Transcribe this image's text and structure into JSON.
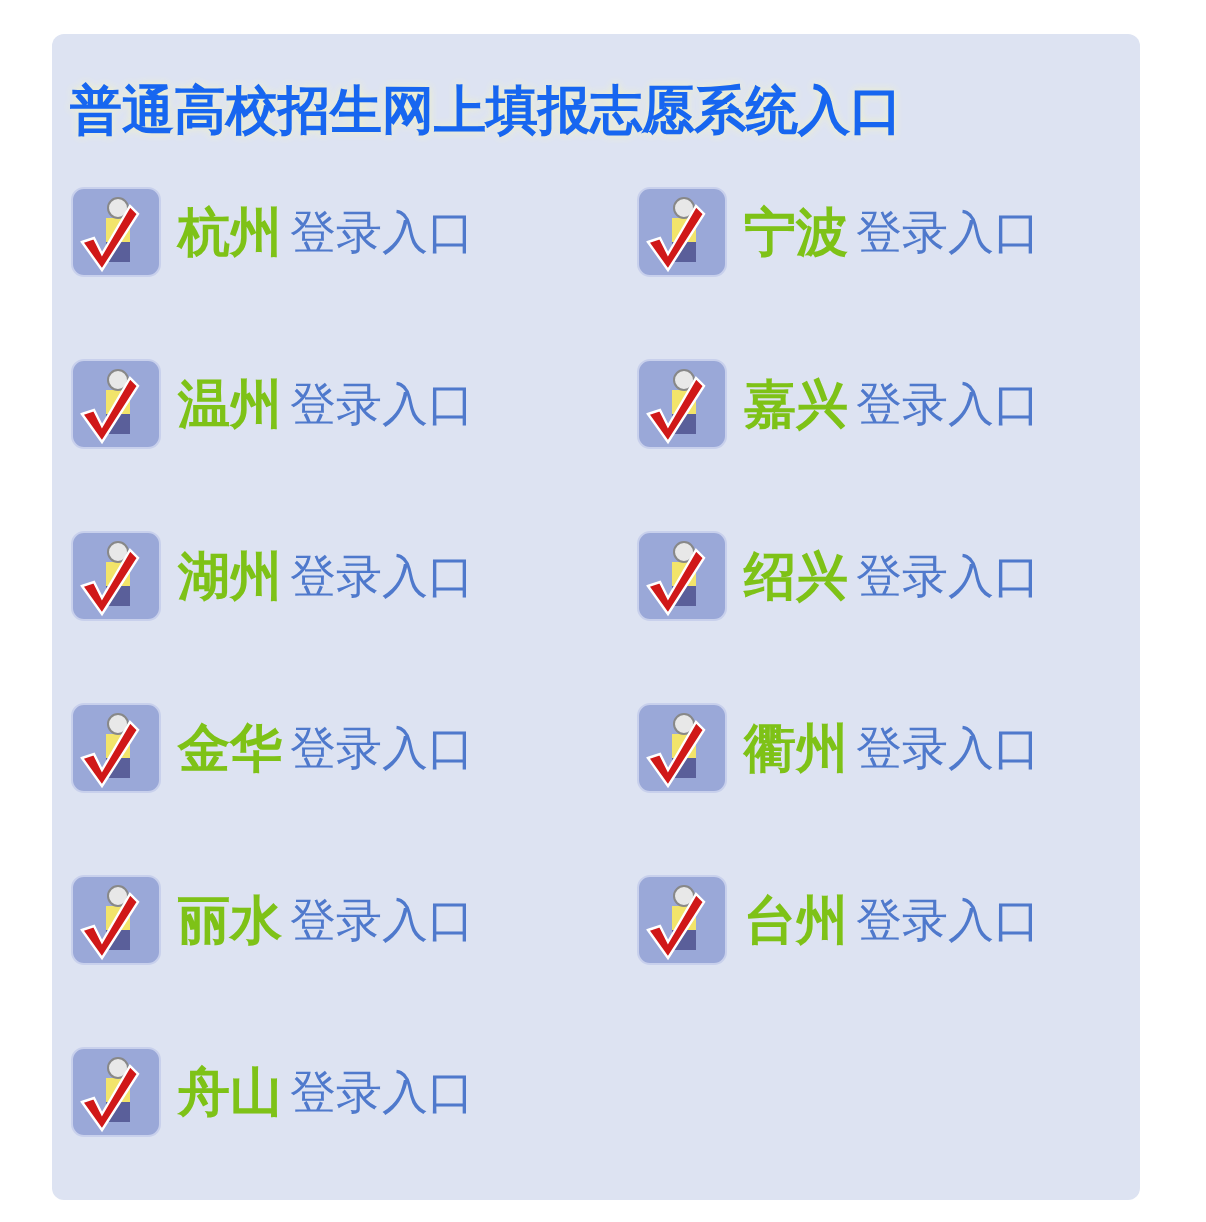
{
  "title": "普通高校招生网上填报志愿系统入口",
  "entries": [
    {
      "city": "杭州",
      "suffix": "登录入口"
    },
    {
      "city": "宁波",
      "suffix": "登录入口"
    },
    {
      "city": "温州",
      "suffix": "登录入口"
    },
    {
      "city": "嘉兴",
      "suffix": "登录入口"
    },
    {
      "city": "湖州",
      "suffix": "登录入口"
    },
    {
      "city": "绍兴",
      "suffix": "登录入口"
    },
    {
      "city": "金华",
      "suffix": "登录入口"
    },
    {
      "city": "衢州",
      "suffix": "登录入口"
    },
    {
      "city": "丽水",
      "suffix": "登录入口"
    },
    {
      "city": "台州",
      "suffix": "登录入口"
    },
    {
      "city": "舟山",
      "suffix": "登录入口"
    }
  ]
}
